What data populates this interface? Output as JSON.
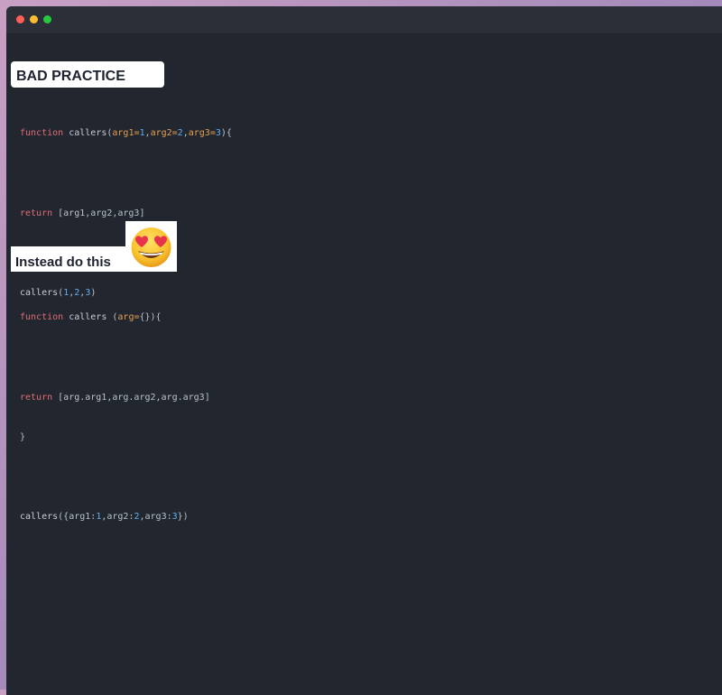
{
  "window": {
    "controls": [
      "close",
      "minimize",
      "maximize"
    ],
    "colors": {
      "close": "#ff5f57",
      "minimize": "#febc2e",
      "maximize": "#28c840"
    }
  },
  "section_bad": {
    "heading": "BAD PRACTICE",
    "code": {
      "line1": {
        "kw": "function",
        "name": "callers",
        "open": "(",
        "p1": "arg1=",
        "v1": "1",
        "c1": ",",
        "p2": "arg2=",
        "v2": "2",
        "c2": ",",
        "p3": "arg3=",
        "v3": "3",
        "close": "){"
      },
      "line3": {
        "kw": "return",
        "rest": " [arg1,arg2,arg3]"
      },
      "line4": {
        "text": "}"
      },
      "line5": {
        "name": "callers",
        "open": "(",
        "v1": "1",
        "c1": ",",
        "v2": "2",
        "c2": ",",
        "v3": "3",
        "close": ")"
      }
    }
  },
  "section_good": {
    "heading": "Instead  do this",
    "emoji": "heart-eyes-emoji-icon",
    "code": {
      "line1": {
        "kw": "function",
        "name": "callers",
        "open": " (",
        "p1": "arg=",
        "rest": "{}){"
      },
      "line3": {
        "kw": "return",
        "rest": " [arg.arg1,arg.arg2,arg.arg3]"
      },
      "line4": {
        "text": "}"
      },
      "line6": {
        "name": "callers",
        "open": "({arg1:",
        "v1": "1",
        "m1": ",arg2:",
        "v2": "2",
        "m2": ",arg3:",
        "v3": "3",
        "close": "})"
      }
    }
  },
  "colors": {
    "editor_bg": "#22262e",
    "keyword": "#e06c75",
    "param": "#e5a054",
    "number": "#61afef",
    "text": "#b9c0cc"
  }
}
